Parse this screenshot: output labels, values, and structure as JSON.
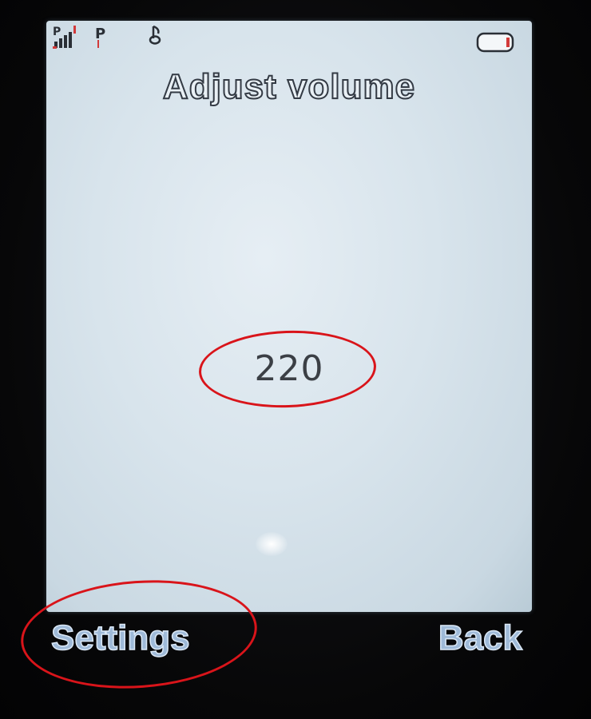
{
  "screen": {
    "title": "Adjust volume",
    "value": "220"
  },
  "status_bar": {
    "signal_icon": "signal-strength-icon",
    "gprs_icon": "gprs-icon",
    "music_icon": "music-note-icon",
    "battery_icon": "battery-icon",
    "gprs_label": "P"
  },
  "softkeys": {
    "left": "Settings",
    "right": "Back"
  },
  "colors": {
    "screen_bg": "#d8e4ec",
    "annotation": "#d9141a",
    "softkey_text": "#9fbad8",
    "bezel": "#0b0b0d"
  }
}
